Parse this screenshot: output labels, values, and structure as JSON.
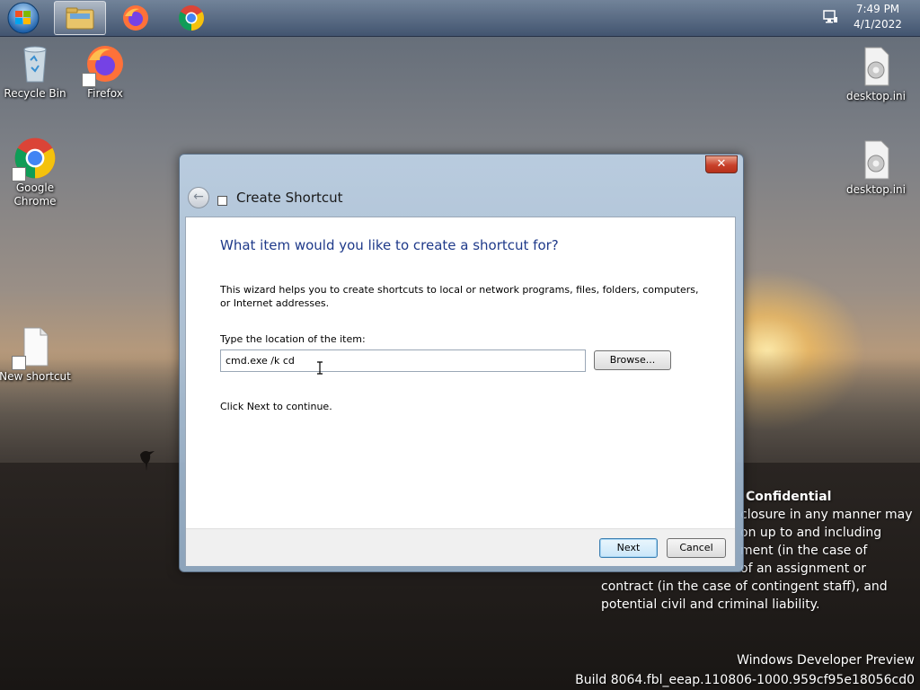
{
  "taskbar": {
    "start": "start-orb",
    "items": [
      {
        "name": "file-explorer",
        "icon": "folder-icon",
        "active": true
      },
      {
        "name": "firefox",
        "icon": "firefox-icon",
        "active": false
      },
      {
        "name": "chrome",
        "icon": "chrome-icon",
        "active": false
      }
    ],
    "clock": {
      "time": "7:49 PM",
      "date": "4/1/2022"
    }
  },
  "desktop": {
    "icons": [
      {
        "label": "Recycle Bin",
        "icon": "recycle-bin-icon"
      },
      {
        "label": "Firefox",
        "icon": "firefox-icon"
      },
      {
        "label": "Google Chrome",
        "icon": "chrome-icon"
      },
      {
        "label": "New shortcut",
        "icon": "shortcut-file-icon"
      },
      {
        "label": "desktop.ini",
        "icon": "settings-file-icon"
      },
      {
        "label": "desktop.ini",
        "icon": "settings-file-icon"
      }
    ],
    "watermark": {
      "confidential_title": "Confidential",
      "lines": [
        "closure in any manner may",
        "on up to and including",
        "ment (in the case of",
        "of an assignment or",
        "contract (in the case of contingent staff), and",
        "potential civil and criminal liability."
      ],
      "build_line1": "Windows Developer Preview",
      "build_line2": "Build 8064.fbl_eeap.110806-1000.959cf95e18056cd0"
    }
  },
  "dialog": {
    "title": "Create Shortcut",
    "close_label": "✕",
    "heading": "What item would you like to create a shortcut for?",
    "description": "This wizard helps you to create shortcuts to local or network programs, files, folders, computers, or Internet addresses.",
    "location_label": "Type the location of the item:",
    "location_value": "cmd.exe /k cd ",
    "browse_label": "Browse...",
    "continue_text": "Click Next to continue.",
    "next_label": "Next",
    "cancel_label": "Cancel"
  }
}
